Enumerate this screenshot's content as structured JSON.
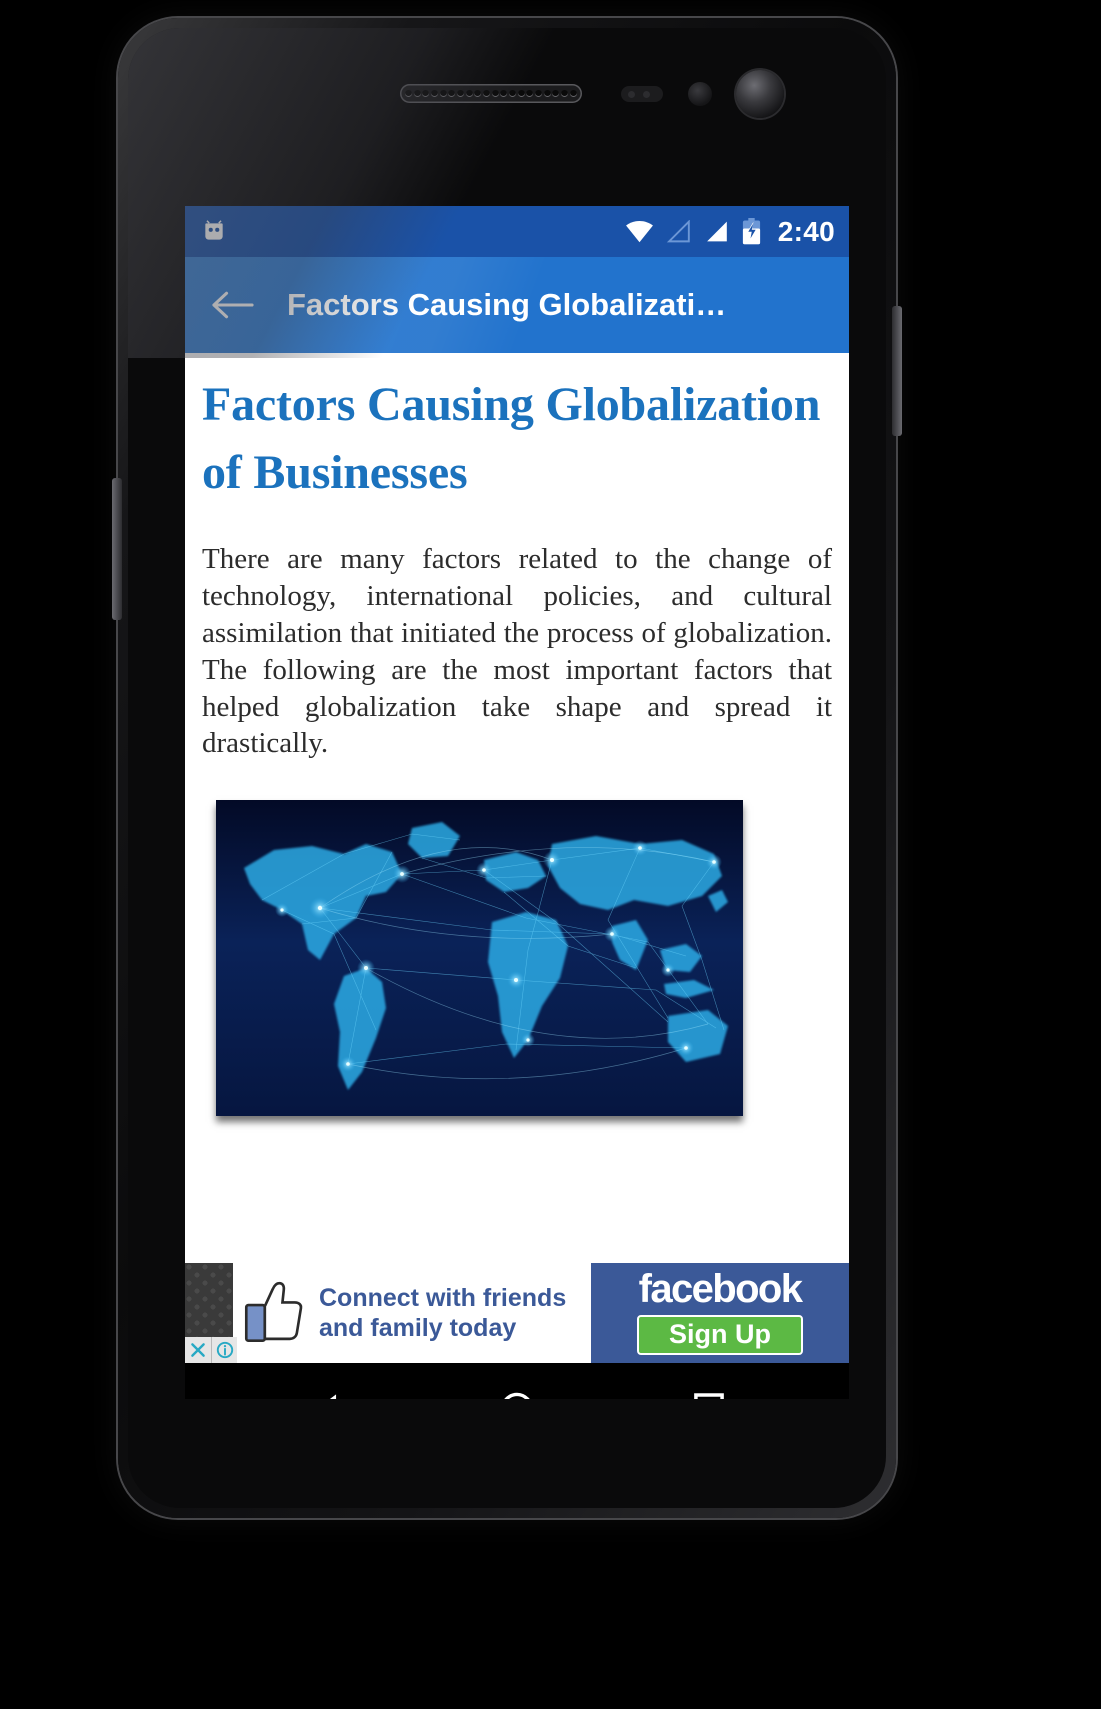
{
  "device": {
    "name": "android-phone",
    "bezel_color": "#0a0a0b"
  },
  "statusbar": {
    "time": "2:40",
    "left_icon": "cyanogenmod-robot-icon",
    "icons": [
      "wifi-icon",
      "signal-empty-icon",
      "signal-full-icon",
      "battery-charging-icon"
    ],
    "background_color": "#1a52a8"
  },
  "actionbar": {
    "back_icon": "back-arrow-icon",
    "title": "Factors Causing Globalizati…",
    "background_color": "#2273cd"
  },
  "article": {
    "title": "Factors Causing Globalization of Businesses",
    "title_color": "#1b72bd",
    "body": "There are many factors related to the change of technology, international policies, and cultural assimilation that initiated the process of globalization. The following are the most important factors that helped globalization take shape and spread it drastically.",
    "image_alt": "world-map-network-connections"
  },
  "ad": {
    "headline_line1": "Connect with friends",
    "headline_line2": "and family today",
    "brand": "facebook",
    "cta_label": "Sign Up",
    "brand_color": "#3b5998",
    "cta_color": "#5cb944",
    "close_icon": "close-x-icon",
    "info_icon": "info-circle-icon",
    "thumb_icon": "thumbs-up-icon"
  },
  "navbar": {
    "back_label": "Back",
    "home_label": "Home",
    "recents_label": "Recent apps",
    "icons": [
      "nav-back-triangle-icon",
      "nav-home-circle-icon",
      "nav-recents-square-icon"
    ],
    "background_color": "#000000"
  }
}
